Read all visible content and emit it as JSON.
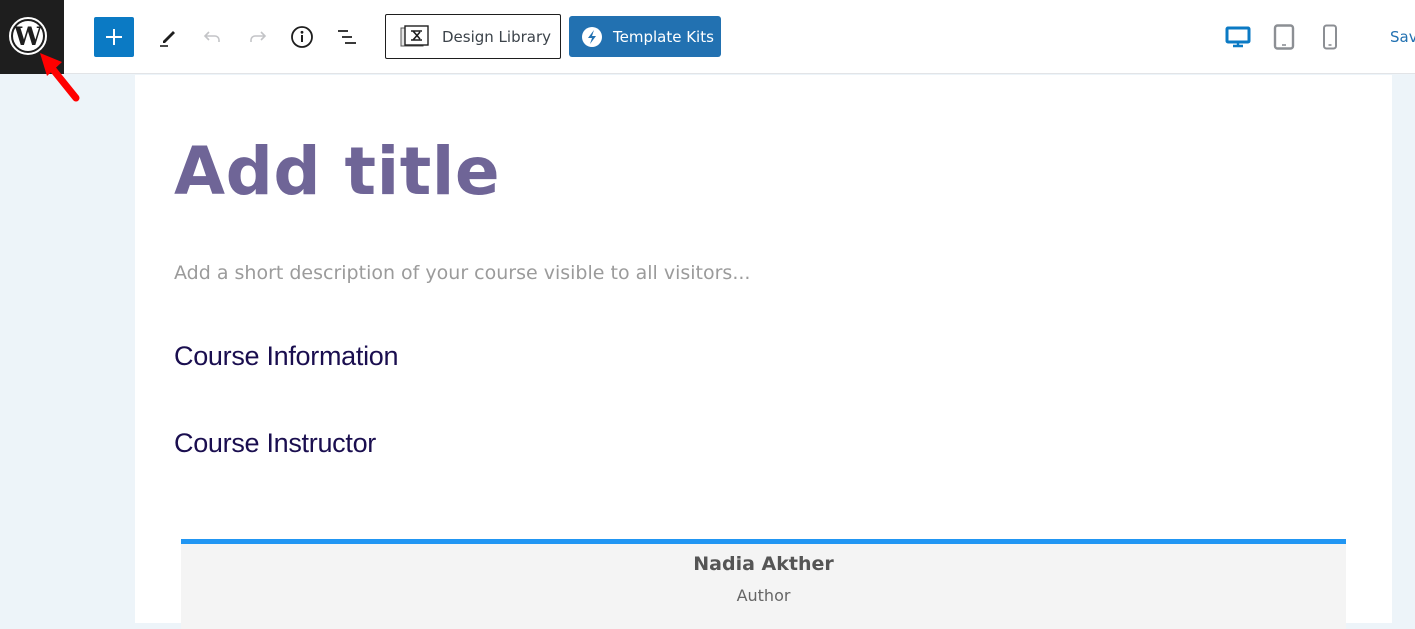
{
  "toolbar": {
    "logo_icon": "wordpress-logo-icon",
    "add_block_label": "+",
    "tools": [
      {
        "name": "edit-tool",
        "icon": "pencil-icon"
      },
      {
        "name": "undo",
        "icon": "undo-icon",
        "disabled": true
      },
      {
        "name": "redo",
        "icon": "redo-icon",
        "disabled": true
      },
      {
        "name": "details",
        "icon": "info-icon"
      },
      {
        "name": "list-view",
        "icon": "list-view-icon"
      }
    ],
    "design_library_label": "Design Library",
    "template_kits_label": "Template Kits",
    "devices": [
      {
        "name": "desktop",
        "icon": "desktop-icon",
        "active": true
      },
      {
        "name": "tablet",
        "icon": "tablet-icon",
        "active": false
      },
      {
        "name": "mobile",
        "icon": "mobile-icon",
        "active": false
      }
    ],
    "save_label": "Sav"
  },
  "editor": {
    "title_placeholder": "Add title",
    "description_placeholder": "Add a short description of your course visible to all visitors...",
    "headings": [
      "Course Information",
      "Course Instructor"
    ],
    "author": {
      "name": "Nadia Akther",
      "role": "Author"
    }
  },
  "colors": {
    "accent_blue": "#0b7ac4",
    "template_kits_blue": "#2271b1",
    "title_purple": "#6f6597",
    "heading_navy": "#1a0e4f",
    "author_border": "#2196f3",
    "annotation_arrow": "#ff0000"
  }
}
